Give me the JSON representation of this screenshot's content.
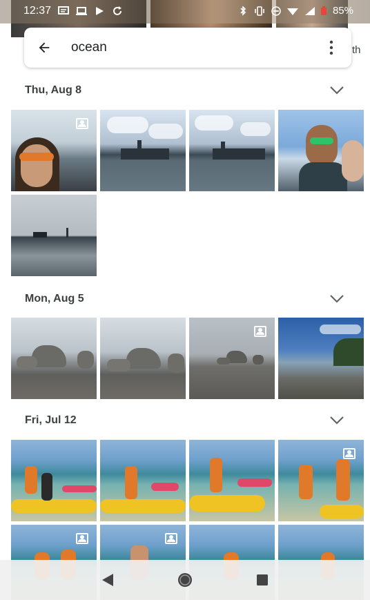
{
  "status_bar": {
    "time": "12:37",
    "battery": "85%",
    "icons": [
      "message-icon",
      "laptop-icon",
      "play-icon",
      "sync-icon",
      "bluetooth-icon",
      "vibrate-icon",
      "dnd-icon",
      "wifi-icon",
      "signal-icon",
      "battery-icon"
    ]
  },
  "search": {
    "query": "ocean",
    "peek_text": "th"
  },
  "sections": [
    {
      "title": "Thu, Aug 8",
      "photos": [
        "selfie",
        "skyline",
        "skyline",
        "selfie-couple",
        "statue-liberty"
      ],
      "portrait_badges": [
        0
      ]
    },
    {
      "title": "Mon, Aug 5",
      "photos": [
        "rocks",
        "rocks",
        "rocks",
        "shoreline"
      ],
      "portrait_badges": [
        2
      ]
    },
    {
      "title": "Fri, Jul 12",
      "photos": [
        "beach-kayak",
        "beach-kayak",
        "beach-kayak",
        "beach-kayak",
        "beach",
        "beach",
        "beach",
        "beach"
      ],
      "portrait_badges": [
        3,
        4,
        5
      ]
    }
  ],
  "colors": {
    "accent": "#202124",
    "section_text": "#3c4043",
    "navbar": "#f0f0f0"
  }
}
